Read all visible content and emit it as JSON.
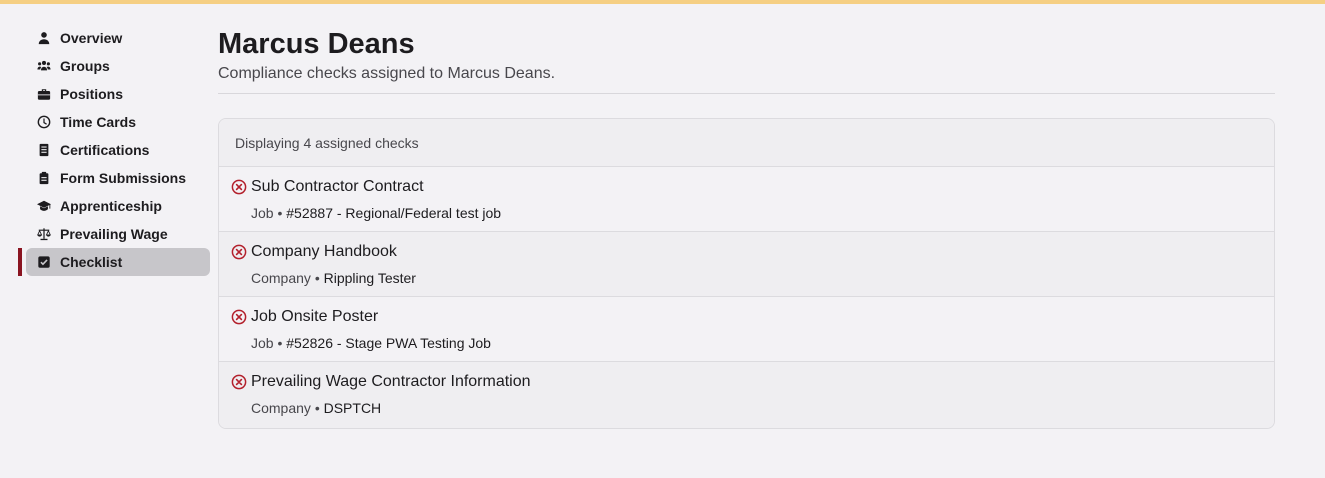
{
  "colors": {
    "accent": "#8a1421",
    "top_strip": "#f5cf83",
    "error_icon": "#b3202c"
  },
  "sidebar": {
    "items": [
      {
        "label": "Overview",
        "icon": "person-icon"
      },
      {
        "label": "Groups",
        "icon": "group-icon"
      },
      {
        "label": "Positions",
        "icon": "briefcase-icon"
      },
      {
        "label": "Time Cards",
        "icon": "clock-icon"
      },
      {
        "label": "Certifications",
        "icon": "document-icon"
      },
      {
        "label": "Form Submissions",
        "icon": "clipboard-icon"
      },
      {
        "label": "Apprenticeship",
        "icon": "graduation-cap-icon"
      },
      {
        "label": "Prevailing Wage",
        "icon": "scale-icon"
      },
      {
        "label": "Checklist",
        "icon": "checkbox-icon",
        "active": true
      }
    ]
  },
  "main": {
    "title": "Marcus Deans",
    "subtitle": "Compliance checks assigned to Marcus Deans.",
    "panel_header": "Displaying 4 assigned checks",
    "checks": [
      {
        "title": "Sub Contractor Contract",
        "type": "Job",
        "detail": "#52887 - Regional/Federal test job",
        "status_icon": "error-circle-icon"
      },
      {
        "title": "Company Handbook",
        "type": "Company",
        "detail": "Rippling Tester",
        "status_icon": "error-circle-icon"
      },
      {
        "title": "Job Onsite Poster",
        "type": "Job",
        "detail": "#52826 - Stage PWA Testing Job",
        "status_icon": "error-circle-icon"
      },
      {
        "title": "Prevailing Wage Contractor Information",
        "type": "Company",
        "detail": "DSPTCH",
        "status_icon": "error-circle-icon"
      }
    ],
    "separator": "•"
  }
}
